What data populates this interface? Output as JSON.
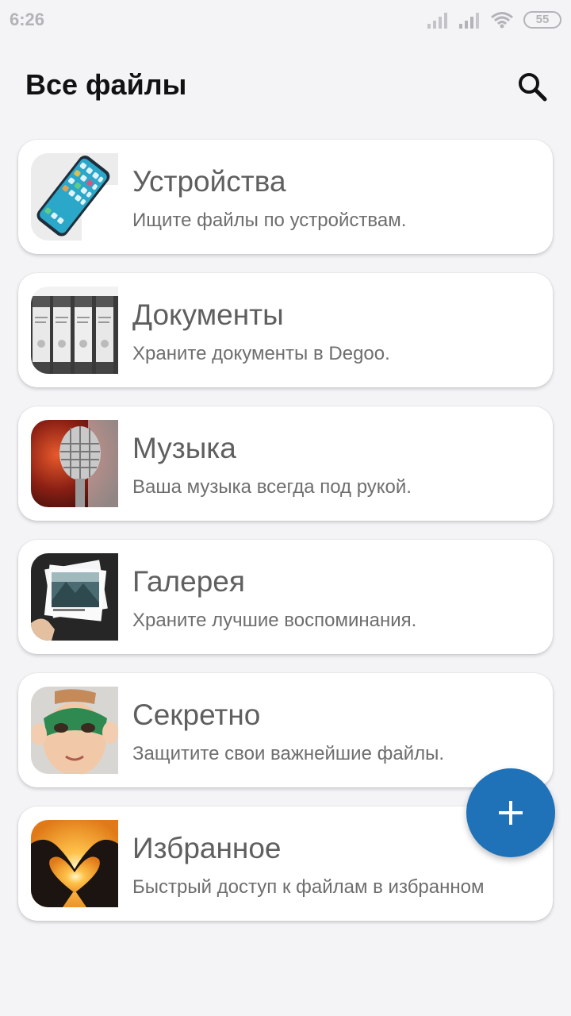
{
  "status_bar": {
    "time": "6:26",
    "battery": "55",
    "icons": [
      "signal-icon",
      "signal-icon",
      "wifi-icon",
      "battery-icon"
    ]
  },
  "header": {
    "title": "Все файлы",
    "search_icon": "search-icon"
  },
  "categories": [
    {
      "title": "Устройства",
      "subtitle": "Ищите файлы по устройствам.",
      "thumbnail": "phone-photo"
    },
    {
      "title": "Документы",
      "subtitle": "Храните документы в Degoo.",
      "thumbnail": "binders-photo"
    },
    {
      "title": "Музыка",
      "subtitle": "Ваша музыка всегда под рукой.",
      "thumbnail": "microphone-photo"
    },
    {
      "title": "Галерея",
      "subtitle": "Храните лучшие воспоминания.",
      "thumbnail": "photos-photo"
    },
    {
      "title": "Секретно",
      "subtitle": "Защитите свои важнейшие файлы.",
      "thumbnail": "masked-child-photo"
    },
    {
      "title": "Избранное",
      "subtitle": "Быстрый доступ к файлам в избранном",
      "thumbnail": "heart-hands-photo"
    }
  ],
  "fab": {
    "icon": "plus-icon",
    "color": "#1f72b8"
  },
  "colors": {
    "background": "#f4f4f7",
    "card": "#ffffff",
    "accent": "#1f72b8"
  }
}
